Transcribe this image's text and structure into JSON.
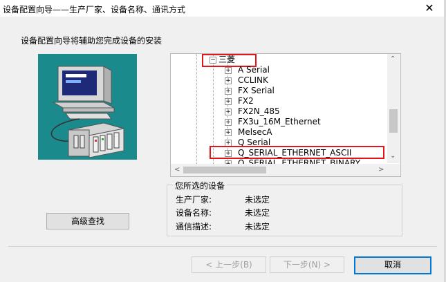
{
  "window": {
    "title": "设备配置向导——生产厂家、设备名称、通讯方式",
    "close_glyph": "✕"
  },
  "intro": "设备配置向导将辅助您完成设备的安装",
  "tree": {
    "root_label": "三菱",
    "items": [
      "A Serial",
      "CCLINK",
      "FX Serial",
      "FX2",
      "FX2N_485",
      "FX3u_16M_Ethernet",
      "MelsecA",
      "Q Serial",
      "Q_SERIAL_ETHERNET_ASCII",
      "Q_SERIAL_ETHERNET_BINARY"
    ],
    "scroll_up": "⌃",
    "scroll_down": "⌄",
    "scroll_left": "<",
    "scroll_right": ">"
  },
  "selection": {
    "title": "您所选的设备",
    "rows": [
      {
        "label": "生产厂家:",
        "value": "未选定"
      },
      {
        "label": "设备名称:",
        "value": "未选定"
      },
      {
        "label": "通信描述:",
        "value": "未选定"
      }
    ]
  },
  "buttons": {
    "advanced": "高级查找",
    "back": "< 上一步(B)",
    "next": "下一步(N) >",
    "cancel": "取消"
  },
  "colors": {
    "highlight": "#e0161b",
    "art_bg": "#1b8a8c",
    "focus": "#0078d7"
  }
}
